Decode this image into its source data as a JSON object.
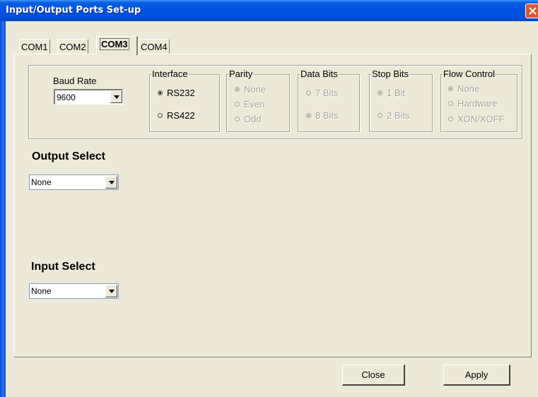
{
  "window": {
    "title": "Input/Output Ports Set-up"
  },
  "tabs": [
    {
      "label": "COM1",
      "active": false
    },
    {
      "label": "COM2",
      "active": false
    },
    {
      "label": "COM3",
      "active": true
    },
    {
      "label": "COM4",
      "active": false
    }
  ],
  "baud_rate": {
    "label": "Baud Rate",
    "value": "9600"
  },
  "interface": {
    "legend": "Interface",
    "options": [
      {
        "label": "RS232",
        "checked": true
      },
      {
        "label": "RS422",
        "checked": false
      }
    ]
  },
  "parity": {
    "legend": "Parity",
    "enabled": false,
    "options": [
      {
        "label": "None",
        "checked": true
      },
      {
        "label": "Even",
        "checked": false
      },
      {
        "label": "Odd",
        "checked": false
      }
    ]
  },
  "data_bits": {
    "legend": "Data Bits",
    "enabled": false,
    "options": [
      {
        "label": "7 Bits",
        "checked": false
      },
      {
        "label": "8 Bits",
        "checked": true
      }
    ]
  },
  "stop_bits": {
    "legend": "Stop Bits",
    "enabled": false,
    "options": [
      {
        "label": "1 Bit",
        "checked": true
      },
      {
        "label": "2 Bits",
        "checked": false
      }
    ]
  },
  "flow_control": {
    "legend": "Flow Control",
    "enabled": false,
    "options": [
      {
        "label": "None",
        "checked": true
      },
      {
        "label": "Hardware",
        "checked": false
      },
      {
        "label": "XON/XOFF",
        "checked": false
      }
    ]
  },
  "output_select": {
    "heading": "Output Select",
    "value": "None"
  },
  "input_select": {
    "heading": "Input Select",
    "value": "None"
  },
  "buttons": {
    "close_label": "Close",
    "apply_label": "Apply"
  },
  "colors": {
    "titlebar": "#0054e3",
    "face": "#ece9d8",
    "close_button": "#e2552f",
    "disabled_text": "#a7a69e"
  }
}
